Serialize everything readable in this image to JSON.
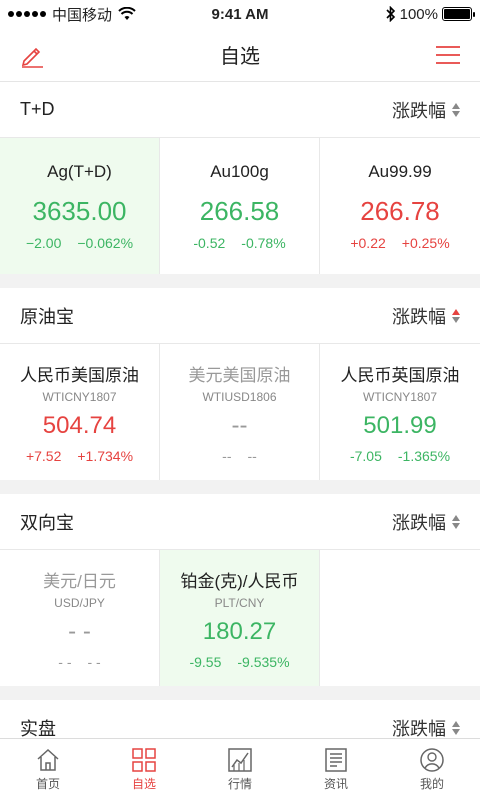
{
  "status": {
    "carrier": "中国移动",
    "time": "9:41 AM",
    "battery": "100%",
    "battery_level": 1.0
  },
  "nav": {
    "title": "自选"
  },
  "sort_label": "涨跌幅",
  "sections": [
    {
      "title": "T+D",
      "items": [
        {
          "name": "Ag(T+D)",
          "price": "3635.00",
          "change": "−2.00",
          "pct": "−0.062%"
        },
        {
          "name": "Au100g",
          "price": "266.58",
          "change": "-0.52",
          "pct": "-0.78%"
        },
        {
          "name": "Au99.99",
          "price": "266.78",
          "change": "+0.22",
          "pct": "+0.25%"
        }
      ]
    },
    {
      "title": "原油宝",
      "items": [
        {
          "name": "人民币美国原油",
          "code": "WTICNY1807",
          "price": "504.74",
          "change": "+7.52",
          "pct": "+1.734%"
        },
        {
          "name": "美元美国原油",
          "code": "WTIUSD1806",
          "price": "--",
          "change": "--",
          "pct": "--"
        },
        {
          "name": "人民币英国原油",
          "code": "WTICNY1807",
          "price": "501.99",
          "change": "-7.05",
          "pct": "-1.365%"
        }
      ]
    },
    {
      "title": "双向宝",
      "items": [
        {
          "name": "美元/日元",
          "code": "USD/JPY",
          "price": "- -",
          "change": "- -",
          "pct": "- -"
        },
        {
          "name": "铂金(克)/人民币",
          "code": "PLT/CNY",
          "price": "180.27",
          "change": "-9.55",
          "pct": "-9.535%"
        }
      ]
    },
    {
      "title": "实盘"
    }
  ],
  "tabs": [
    {
      "label": "首页",
      "icon": "home-icon"
    },
    {
      "label": "自选",
      "icon": "grid-icon"
    },
    {
      "label": "行情",
      "icon": "chart-icon"
    },
    {
      "label": "资讯",
      "icon": "news-icon"
    },
    {
      "label": "我的",
      "icon": "user-icon"
    }
  ],
  "colors": {
    "accent": "#e64340",
    "up": "#e64340",
    "down": "#3cb563",
    "highlight": "#effbee"
  }
}
